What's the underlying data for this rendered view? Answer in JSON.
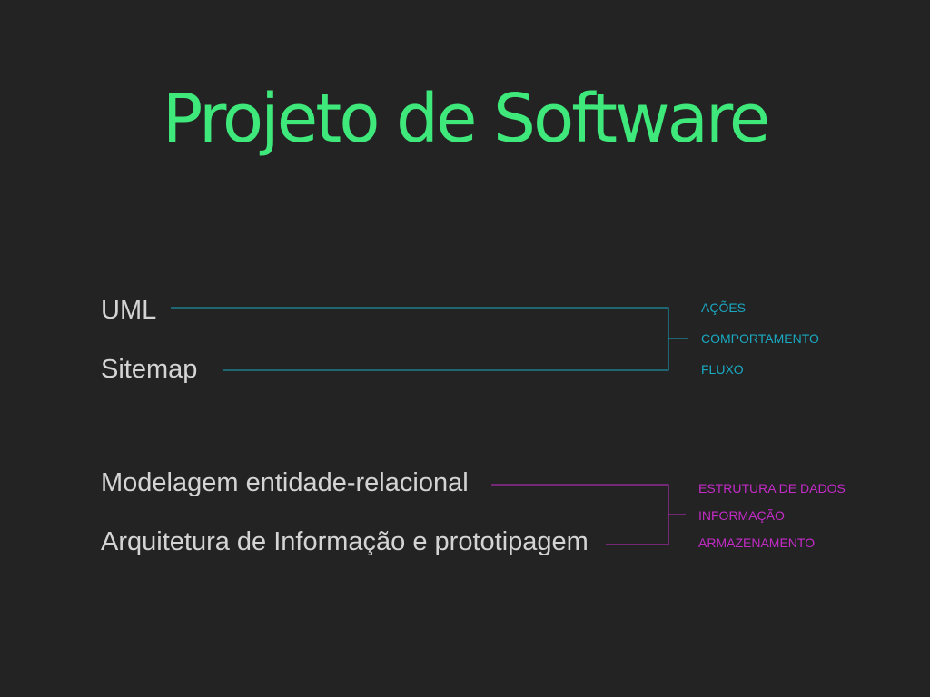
{
  "title": "Projeto de Software",
  "colors": {
    "background": "#232323",
    "title": "#3ee87a",
    "text": "#d4d4d4",
    "behavior_group": "#1aa9c2",
    "data_group": "#c32bc7"
  },
  "groups": [
    {
      "items": [
        "UML",
        "Sitemap"
      ],
      "tags": [
        "AÇÕES",
        "COMPORTAMENTO",
        "FLUXO"
      ]
    },
    {
      "items": [
        "Modelagem entidade-relacional",
        "Arquitetura de Informação e prototipagem"
      ],
      "tags": [
        "ESTRUTURA DE DADOS",
        "INFORMAÇÃO",
        "ARMAZENAMENTO"
      ]
    }
  ]
}
